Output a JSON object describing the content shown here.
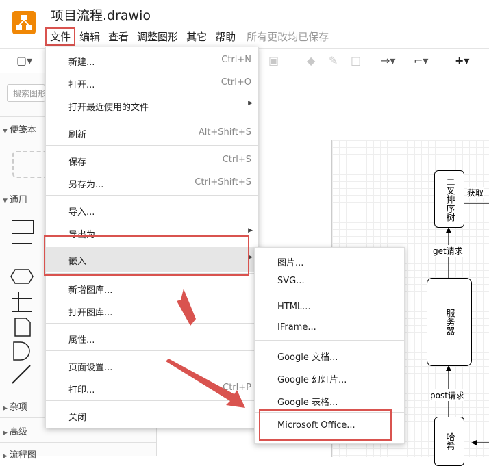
{
  "app": {
    "title": "项目流程.drawio",
    "logo_icon": "drawio-logo-icon",
    "brand_color": "#f08705",
    "highlight_color": "#d9534f"
  },
  "menubar": {
    "items": [
      "文件",
      "编辑",
      "查看",
      "调整图形",
      "其它",
      "帮助"
    ],
    "status": "所有更改均已保存"
  },
  "sidebar": {
    "search_placeholder": "搜索图形",
    "sections": [
      "便笺本",
      "通用",
      "杂项",
      "高级",
      "流程图"
    ]
  },
  "file_menu": {
    "items": [
      {
        "label": "新建...",
        "shortcut": "Ctrl+N"
      },
      {
        "label": "打开...",
        "shortcut": "Ctrl+O"
      },
      {
        "label": "打开最近使用的文件",
        "shortcut": ""
      },
      {
        "label": "刷新",
        "shortcut": "Alt+Shift+S"
      },
      {
        "label": "保存",
        "shortcut": "Ctrl+S"
      },
      {
        "label": "另存为...",
        "shortcut": "Ctrl+Shift+S"
      },
      {
        "label": "导入...",
        "shortcut": ""
      },
      {
        "label": "导出为",
        "shortcut": ""
      },
      {
        "label": "嵌入",
        "shortcut": ""
      },
      {
        "label": "新增图库...",
        "shortcut": ""
      },
      {
        "label": "打开图库...",
        "shortcut": ""
      },
      {
        "label": "属性...",
        "shortcut": ""
      },
      {
        "label": "页面设置...",
        "shortcut": ""
      },
      {
        "label": "打印...",
        "shortcut": "Ctrl+P"
      },
      {
        "label": "关闭",
        "shortcut": ""
      }
    ]
  },
  "embed_submenu": {
    "items": [
      "图片...",
      "SVG...",
      "HTML...",
      "IFrame...",
      "Google 文档...",
      "Google 幻灯片...",
      "Google 表格...",
      "Microsoft Office..."
    ]
  },
  "diagram": {
    "nodes": [
      "二叉排序树",
      "服务器",
      "哈希"
    ],
    "edges": [
      "获取",
      "get请求",
      "post请求"
    ]
  }
}
